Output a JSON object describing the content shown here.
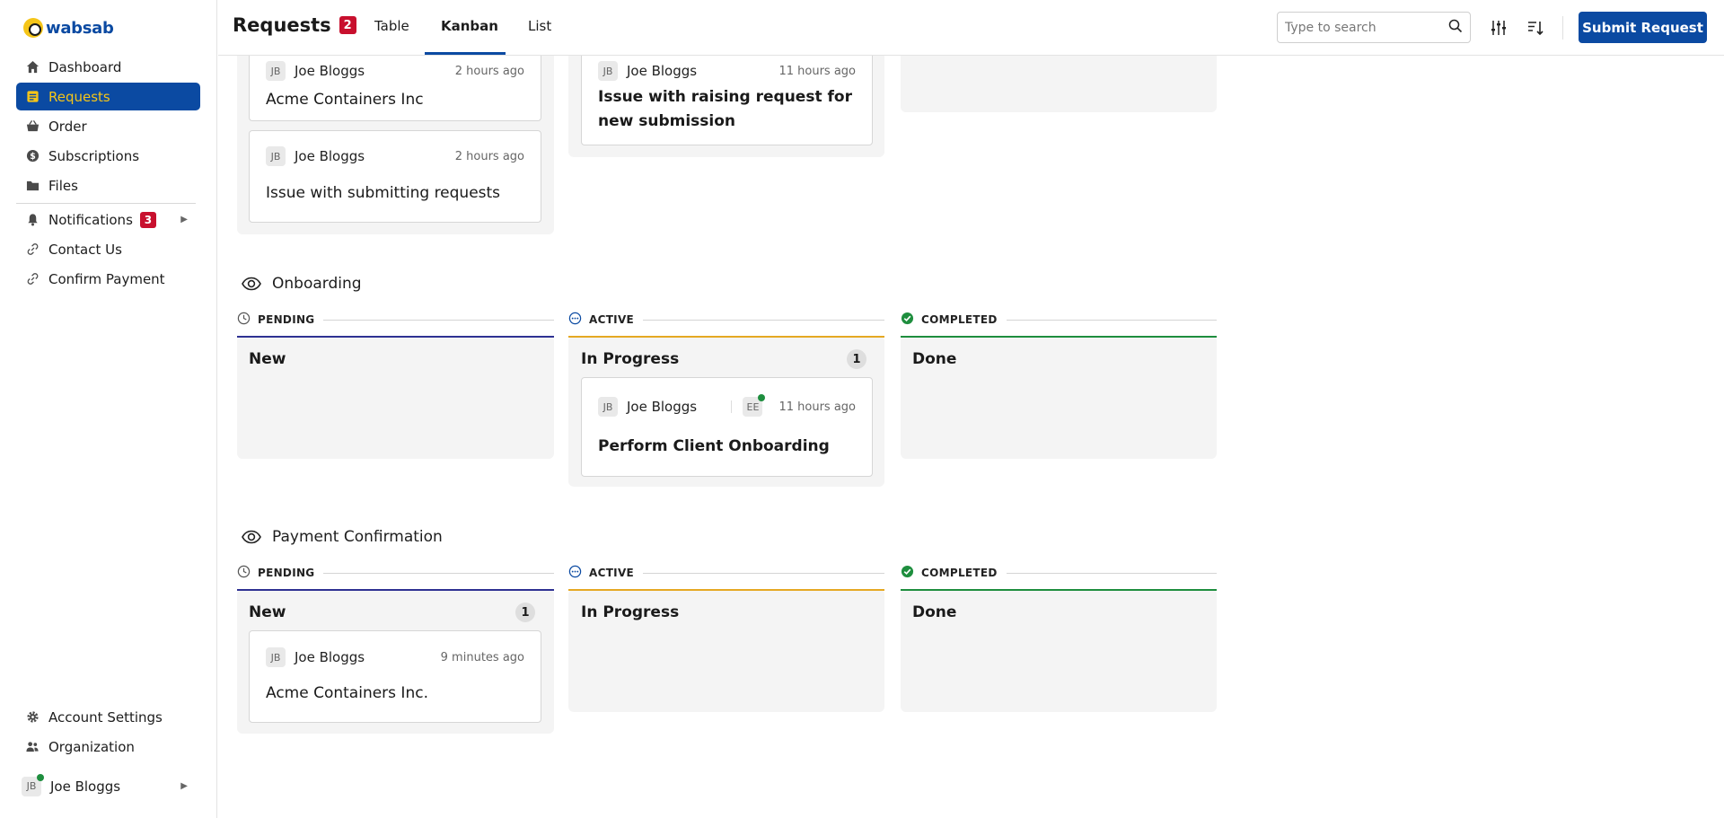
{
  "app": {
    "name": "wabsab"
  },
  "sidebar": {
    "items": [
      {
        "label": "Dashboard",
        "icon": "home-icon"
      },
      {
        "label": "Requests",
        "icon": "requests-icon"
      },
      {
        "label": "Order",
        "icon": "basket-icon"
      },
      {
        "label": "Subscriptions",
        "icon": "dollar-icon"
      },
      {
        "label": "Files",
        "icon": "folder-icon"
      },
      {
        "label": "Notifications",
        "icon": "bell-icon",
        "badge": "3"
      },
      {
        "label": "Contact Us",
        "icon": "link-icon"
      },
      {
        "label": "Confirm Payment",
        "icon": "link-icon"
      }
    ],
    "bottom": [
      {
        "label": "Account Settings",
        "icon": "gear-icon"
      },
      {
        "label": "Organization",
        "icon": "users-icon"
      }
    ],
    "user": {
      "initials": "JB",
      "name": "Joe Bloggs"
    }
  },
  "header": {
    "title": "Requests",
    "count": "2",
    "tabs": [
      "Table",
      "Kanban",
      "List"
    ],
    "active_tab": "Kanban",
    "search_placeholder": "Type to search",
    "submit_label": "Submit Request"
  },
  "colors": {
    "brand": "#0b4aa2",
    "accent": "#f5c518",
    "pending": "#2e3192",
    "active": "#e5a823",
    "completed": "#1e8e3e",
    "badge": "#c8102e"
  },
  "top_section": {
    "cards": [
      {
        "initials": "JB",
        "name": "Joe Bloggs",
        "time": "2 hours ago",
        "title": "Acme Containers Inc"
      },
      {
        "initials": "JB",
        "name": "Joe Bloggs",
        "time": "2 hours ago",
        "title": "Issue with submitting requests"
      },
      {
        "initials": "JB",
        "name": "Joe Bloggs",
        "time": "11 hours ago",
        "title": "Issue with raising request for new submission"
      }
    ]
  },
  "onboarding": {
    "title": "Onboarding",
    "statuses": [
      "PENDING",
      "ACTIVE",
      "COMPLETED"
    ],
    "columns": [
      {
        "name": "New"
      },
      {
        "name": "In Progress",
        "count": "1"
      },
      {
        "name": "Done"
      }
    ],
    "card": {
      "initials": "JB",
      "name": "Joe Bloggs",
      "assignee": "EE",
      "time": "11 hours ago",
      "title": "Perform Client Onboarding"
    }
  },
  "payment": {
    "title": "Payment Confirmation",
    "statuses": [
      "PENDING",
      "ACTIVE",
      "COMPLETED"
    ],
    "columns": [
      {
        "name": "New",
        "count": "1"
      },
      {
        "name": "In Progress"
      },
      {
        "name": "Done"
      }
    ],
    "card": {
      "initials": "JB",
      "name": "Joe Bloggs",
      "time": "9 minutes ago",
      "title": "Acme Containers Inc."
    }
  }
}
